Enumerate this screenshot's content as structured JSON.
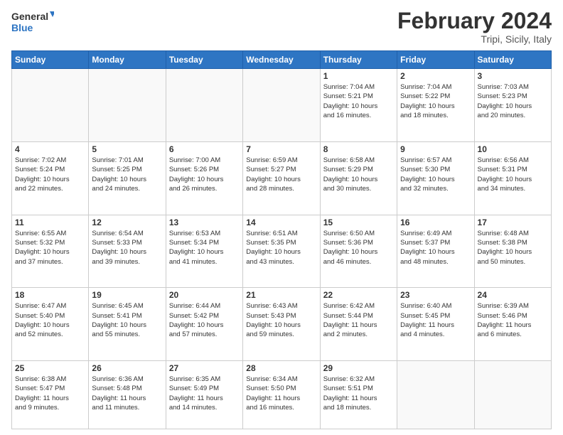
{
  "header": {
    "logo_text_top": "General",
    "logo_text_bottom": "Blue",
    "month_year": "February 2024",
    "location": "Tripi, Sicily, Italy"
  },
  "days_of_week": [
    "Sunday",
    "Monday",
    "Tuesday",
    "Wednesday",
    "Thursday",
    "Friday",
    "Saturday"
  ],
  "weeks": [
    [
      {
        "day": "",
        "info": ""
      },
      {
        "day": "",
        "info": ""
      },
      {
        "day": "",
        "info": ""
      },
      {
        "day": "",
        "info": ""
      },
      {
        "day": "1",
        "info": "Sunrise: 7:04 AM\nSunset: 5:21 PM\nDaylight: 10 hours\nand 16 minutes."
      },
      {
        "day": "2",
        "info": "Sunrise: 7:04 AM\nSunset: 5:22 PM\nDaylight: 10 hours\nand 18 minutes."
      },
      {
        "day": "3",
        "info": "Sunrise: 7:03 AM\nSunset: 5:23 PM\nDaylight: 10 hours\nand 20 minutes."
      }
    ],
    [
      {
        "day": "4",
        "info": "Sunrise: 7:02 AM\nSunset: 5:24 PM\nDaylight: 10 hours\nand 22 minutes."
      },
      {
        "day": "5",
        "info": "Sunrise: 7:01 AM\nSunset: 5:25 PM\nDaylight: 10 hours\nand 24 minutes."
      },
      {
        "day": "6",
        "info": "Sunrise: 7:00 AM\nSunset: 5:26 PM\nDaylight: 10 hours\nand 26 minutes."
      },
      {
        "day": "7",
        "info": "Sunrise: 6:59 AM\nSunset: 5:27 PM\nDaylight: 10 hours\nand 28 minutes."
      },
      {
        "day": "8",
        "info": "Sunrise: 6:58 AM\nSunset: 5:29 PM\nDaylight: 10 hours\nand 30 minutes."
      },
      {
        "day": "9",
        "info": "Sunrise: 6:57 AM\nSunset: 5:30 PM\nDaylight: 10 hours\nand 32 minutes."
      },
      {
        "day": "10",
        "info": "Sunrise: 6:56 AM\nSunset: 5:31 PM\nDaylight: 10 hours\nand 34 minutes."
      }
    ],
    [
      {
        "day": "11",
        "info": "Sunrise: 6:55 AM\nSunset: 5:32 PM\nDaylight: 10 hours\nand 37 minutes."
      },
      {
        "day": "12",
        "info": "Sunrise: 6:54 AM\nSunset: 5:33 PM\nDaylight: 10 hours\nand 39 minutes."
      },
      {
        "day": "13",
        "info": "Sunrise: 6:53 AM\nSunset: 5:34 PM\nDaylight: 10 hours\nand 41 minutes."
      },
      {
        "day": "14",
        "info": "Sunrise: 6:51 AM\nSunset: 5:35 PM\nDaylight: 10 hours\nand 43 minutes."
      },
      {
        "day": "15",
        "info": "Sunrise: 6:50 AM\nSunset: 5:36 PM\nDaylight: 10 hours\nand 46 minutes."
      },
      {
        "day": "16",
        "info": "Sunrise: 6:49 AM\nSunset: 5:37 PM\nDaylight: 10 hours\nand 48 minutes."
      },
      {
        "day": "17",
        "info": "Sunrise: 6:48 AM\nSunset: 5:38 PM\nDaylight: 10 hours\nand 50 minutes."
      }
    ],
    [
      {
        "day": "18",
        "info": "Sunrise: 6:47 AM\nSunset: 5:40 PM\nDaylight: 10 hours\nand 52 minutes."
      },
      {
        "day": "19",
        "info": "Sunrise: 6:45 AM\nSunset: 5:41 PM\nDaylight: 10 hours\nand 55 minutes."
      },
      {
        "day": "20",
        "info": "Sunrise: 6:44 AM\nSunset: 5:42 PM\nDaylight: 10 hours\nand 57 minutes."
      },
      {
        "day": "21",
        "info": "Sunrise: 6:43 AM\nSunset: 5:43 PM\nDaylight: 10 hours\nand 59 minutes."
      },
      {
        "day": "22",
        "info": "Sunrise: 6:42 AM\nSunset: 5:44 PM\nDaylight: 11 hours\nand 2 minutes."
      },
      {
        "day": "23",
        "info": "Sunrise: 6:40 AM\nSunset: 5:45 PM\nDaylight: 11 hours\nand 4 minutes."
      },
      {
        "day": "24",
        "info": "Sunrise: 6:39 AM\nSunset: 5:46 PM\nDaylight: 11 hours\nand 6 minutes."
      }
    ],
    [
      {
        "day": "25",
        "info": "Sunrise: 6:38 AM\nSunset: 5:47 PM\nDaylight: 11 hours\nand 9 minutes."
      },
      {
        "day": "26",
        "info": "Sunrise: 6:36 AM\nSunset: 5:48 PM\nDaylight: 11 hours\nand 11 minutes."
      },
      {
        "day": "27",
        "info": "Sunrise: 6:35 AM\nSunset: 5:49 PM\nDaylight: 11 hours\nand 14 minutes."
      },
      {
        "day": "28",
        "info": "Sunrise: 6:34 AM\nSunset: 5:50 PM\nDaylight: 11 hours\nand 16 minutes."
      },
      {
        "day": "29",
        "info": "Sunrise: 6:32 AM\nSunset: 5:51 PM\nDaylight: 11 hours\nand 18 minutes."
      },
      {
        "day": "",
        "info": ""
      },
      {
        "day": "",
        "info": ""
      }
    ]
  ]
}
